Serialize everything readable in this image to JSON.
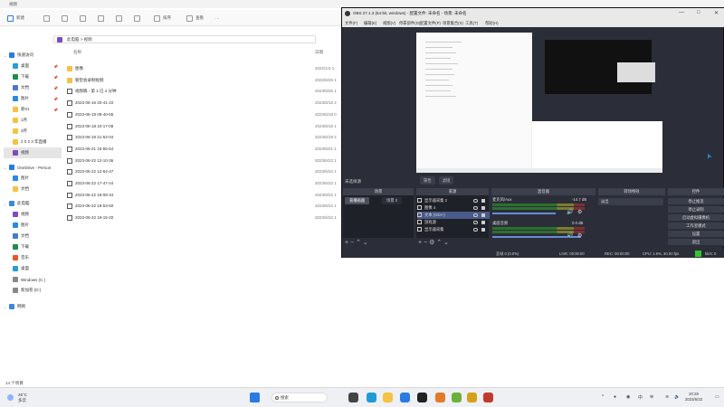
{
  "explorer": {
    "title": "视频",
    "toolbar": {
      "new": "新建",
      "sort": "排序",
      "view": "查看",
      "more": "···"
    },
    "breadcrumb": [
      "此电脑",
      "视频"
    ],
    "columns": {
      "name": "名称",
      "date": "日期"
    },
    "sidebar": [
      {
        "label": "快速访问",
        "color": "#2a7ae2",
        "pin": ""
      },
      {
        "label": "桌面",
        "color": "#2a9ad8",
        "pin": "📌"
      },
      {
        "label": "下载",
        "color": "#1e8c4b",
        "pin": "📌"
      },
      {
        "label": "文档",
        "color": "#4a7ac8",
        "pin": "📌"
      },
      {
        "label": "图片",
        "color": "#2a8ae2",
        "pin": "📌"
      },
      {
        "label": "新01",
        "color": "#f5c243",
        "pin": "📌"
      },
      {
        "label": "1月",
        "color": "#f5c243",
        "pin": ""
      },
      {
        "label": "3月",
        "color": "#f5c243",
        "pin": ""
      },
      {
        "label": "2 0 2 3 年直播",
        "color": "#f5c243",
        "pin": ""
      },
      {
        "label": "视频",
        "color": "#7a4fb8",
        "pin": ""
      },
      {
        "label": "OneDrive - Person",
        "color": "#2a7ae2",
        "pin": ""
      },
      {
        "label": "图片",
        "color": "#2a8ae2",
        "pin": ""
      },
      {
        "label": "文档",
        "color": "#f5c243",
        "pin": ""
      },
      {
        "label": "此电脑",
        "color": "#3a8ad8",
        "pin": ""
      },
      {
        "label": "视频",
        "color": "#7a4fb8",
        "pin": ""
      },
      {
        "label": "图片",
        "color": "#2a8ae2",
        "pin": ""
      },
      {
        "label": "文档",
        "color": "#4a7ac8",
        "pin": ""
      },
      {
        "label": "下载",
        "color": "#1e8c4b",
        "pin": ""
      },
      {
        "label": "音乐",
        "color": "#e25a2a",
        "pin": ""
      },
      {
        "label": "桌面",
        "color": "#2a9ad8",
        "pin": ""
      },
      {
        "label": "Windows (C:)",
        "color": "#888888",
        "pin": ""
      },
      {
        "label": "新加卷 (D:)",
        "color": "#888888",
        "pin": ""
      },
      {
        "label": "网络",
        "color": "#3a8ad8",
        "pin": ""
      }
    ],
    "files": [
      {
        "name": "图像",
        "date": "2022/1/4 1",
        "kind": "folder"
      },
      {
        "name": "狠垫会录制视频",
        "date": "2022/6/25 1",
        "kind": "folder"
      },
      {
        "name": "视频稿 - 第 1 已 4 分钟",
        "date": "2023/5/26 1",
        "kind": "video"
      },
      {
        "name": "2023-06-16 20-41-10",
        "date": "2023/6/16 2",
        "kind": "video"
      },
      {
        "name": "2023-06-18 08-40-55",
        "date": "2023/6/18 0",
        "kind": "video"
      },
      {
        "name": "2023-06-18 10-17-08",
        "date": "2023/6/18 1",
        "kind": "video"
      },
      {
        "name": "2023-06-18 21-52-04",
        "date": "2023/6/18 2",
        "kind": "video"
      },
      {
        "name": "2023-06-21 15-55-54",
        "date": "2023/6/21 1",
        "kind": "video"
      },
      {
        "name": "2023-06-22 12-10-36",
        "date": "2023/6/22 1",
        "kind": "video"
      },
      {
        "name": "2023-06-22 12-54-47",
        "date": "2023/6/22 1",
        "kind": "video"
      },
      {
        "name": "2023-06-22 17-47-44",
        "date": "2023/6/22 1",
        "kind": "video"
      },
      {
        "name": "2023-06-22 18-08-34",
        "date": "2023/6/22 1",
        "kind": "video"
      },
      {
        "name": "2023-06-22 18-53-50",
        "date": "2023/6/22 1",
        "kind": "video"
      },
      {
        "name": "2023-06-22 19-15-20",
        "date": "2023/6/22 1",
        "kind": "video"
      }
    ],
    "status": "14 个项目"
  },
  "obs": {
    "title": "OBS 27.1.3 (64-bit, windows) - 配置文件: 未命名 - 场景: 未命名",
    "menu": [
      "文件(F)",
      "编辑(E)",
      "视图(V)",
      "停靠部件(D)",
      "配置文件(P)",
      "场景集合(S)",
      "工具(T)",
      "帮助(H)"
    ],
    "scene_label": "未选择源",
    "mid_buttons": [
      "属性",
      "滤镜"
    ],
    "docks": {
      "scenes": "场景",
      "sources": "来源",
      "mixer": "混音器",
      "transitions": "转场特效",
      "controls": "控件"
    },
    "scene_tabs": [
      "直播画面",
      "场景 2"
    ],
    "sources": [
      {
        "label": "显示器采集 2",
        "selected": false
      },
      {
        "label": "图像 4",
        "selected": false
      },
      {
        "label": "文本 (GDI+)",
        "selected": true
      },
      {
        "label": "游戏源",
        "selected": false
      },
      {
        "label": "显示器采集",
        "selected": false
      }
    ],
    "mixer": [
      {
        "name": "麦克风/Aux",
        "db": "-14.7 dB"
      },
      {
        "name": "桌面音频",
        "db": "0.0 dB"
      }
    ],
    "transition": "淡出",
    "controls": [
      "停止推流",
      "停止录制",
      "启动虚拟摄像机",
      "工作室模式",
      "设置",
      "退出"
    ],
    "status": {
      "dropped": "丢帧 0 (0.0%)",
      "lv": "LIVE: 00:00:00",
      "rec": "REC: 00:00:00",
      "cpu": "CPU: 1.9%, 30.00 fps",
      "kbps": "kb/s: 0"
    }
  },
  "taskbar": {
    "temp": "26°C",
    "weather": "多云",
    "search": "搜索",
    "time": "20:28",
    "date": "2023/6/22",
    "apps": [
      {
        "name": "start",
        "color": "#2a7ae2"
      },
      {
        "name": "taskview",
        "color": "#444444"
      },
      {
        "name": "edge",
        "color": "#1e9bd7"
      },
      {
        "name": "explorer",
        "color": "#f5c243"
      },
      {
        "name": "mail",
        "color": "#2a7ae2"
      },
      {
        "name": "obs",
        "color": "#222222"
      },
      {
        "name": "app1",
        "color": "#e27a2a"
      },
      {
        "name": "app2",
        "color": "#6ab03a"
      },
      {
        "name": "app3",
        "color": "#d4a017"
      },
      {
        "name": "app4",
        "color": "#c23a2a"
      }
    ]
  }
}
